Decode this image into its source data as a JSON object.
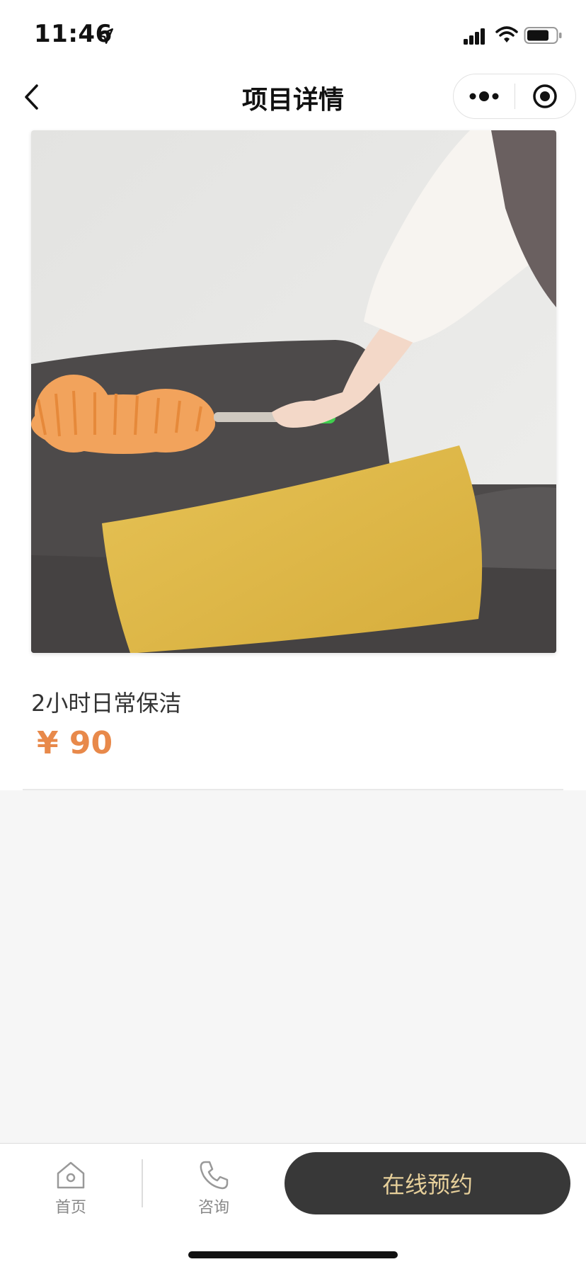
{
  "status_bar": {
    "time": "11:46",
    "icons": [
      "location-arrow-icon",
      "cellular-signal-icon",
      "wifi-icon",
      "battery-icon"
    ]
  },
  "nav": {
    "title": "项目详情",
    "back_icon": "chevron-left-icon",
    "more_icon": "more-dots-icon",
    "close_icon": "target-close-icon"
  },
  "product": {
    "image_description_icon": "cleaning-photo",
    "name": "2小时日常保洁",
    "price": "¥ 90",
    "price_color": "#e8894a"
  },
  "bottom_bar": {
    "tabs": [
      {
        "label": "首页",
        "icon": "home-icon"
      },
      {
        "label": "咨询",
        "icon": "phone-icon"
      }
    ],
    "book_label": "在线预约",
    "book_bg": "#383838",
    "book_text_color": "#e6cf9a"
  }
}
